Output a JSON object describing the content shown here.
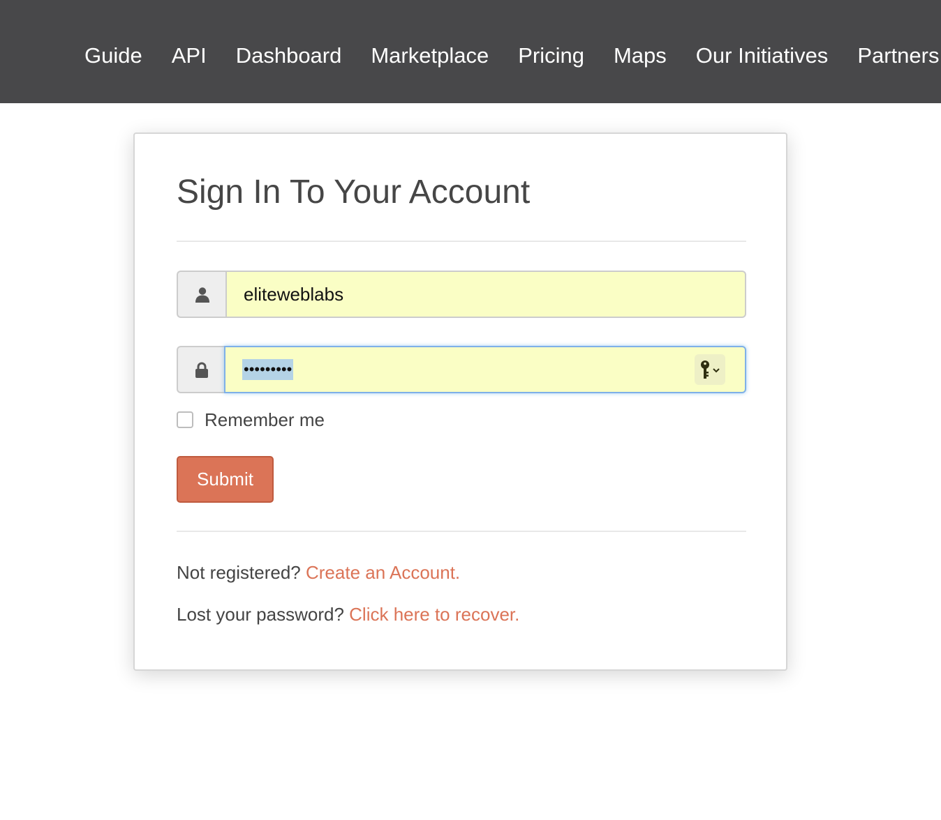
{
  "nav": {
    "items": [
      {
        "label": "Guide"
      },
      {
        "label": "API"
      },
      {
        "label": "Dashboard"
      },
      {
        "label": "Marketplace"
      },
      {
        "label": "Pricing"
      },
      {
        "label": "Maps"
      },
      {
        "label": "Our Initiatives"
      },
      {
        "label": "Partners"
      }
    ]
  },
  "login": {
    "title": "Sign In To Your Account",
    "username_icon": "user-icon",
    "username_value": "eliteweblabs",
    "password_icon": "lock-icon",
    "password_masked": "•••••••••",
    "password_manager_icon": "key-icon",
    "remember_label": "Remember me",
    "remember_checked": false,
    "submit_label": "Submit"
  },
  "footer": {
    "register_prompt": "Not registered?",
    "register_link": "Create an Account.",
    "recover_prompt": "Lost your password?",
    "recover_link": "Click here to recover."
  },
  "colors": {
    "nav_background": "#48484a",
    "accent": "#db7457",
    "autofill_background": "#fafec5",
    "focus_border": "#7fb0e8"
  }
}
